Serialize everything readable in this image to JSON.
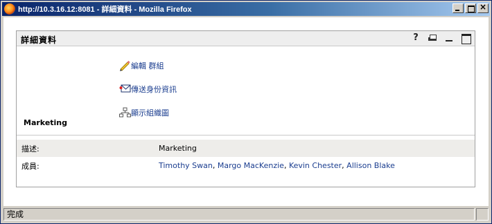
{
  "window": {
    "title": "http://10.3.16.12:8081 - 詳細資料 - Mozilla Firefox"
  },
  "portlet": {
    "title": "詳細資料",
    "tools": {
      "help_label": "?"
    }
  },
  "group": {
    "name": "Marketing"
  },
  "actions": [
    {
      "label": "編輯 群組",
      "icon": "pencil-icon"
    },
    {
      "label": "傳送身份資訊",
      "icon": "mail-icon"
    },
    {
      "label": "顯示組織圖",
      "icon": "org-chart-icon"
    }
  ],
  "details": {
    "description_label": "描述:",
    "description_value": "Marketing",
    "members_label": "成員:",
    "members": [
      "Timothy Swan",
      "Margo MacKenzie",
      "Kevin Chester",
      "Allison Blake"
    ]
  },
  "statusbar": {
    "text": "完成"
  }
}
